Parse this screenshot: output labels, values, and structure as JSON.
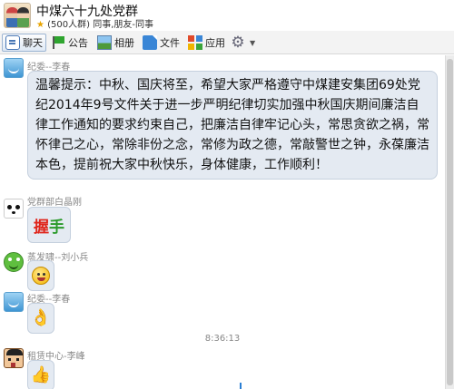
{
  "header": {
    "title": "中煤六十九处党群",
    "subtitle": "(500人群) 同事,朋友-同事"
  },
  "toolbar": {
    "items": [
      {
        "label": "聊天",
        "icon": "chat-icon",
        "active": true
      },
      {
        "label": "公告",
        "icon": "notice-flag-icon"
      },
      {
        "label": "相册",
        "icon": "album-icon"
      },
      {
        "label": "文件",
        "icon": "file-icon"
      },
      {
        "label": "应用",
        "icon": "apps-grid-icon"
      },
      {
        "label": "",
        "icon": "gear-icon"
      }
    ]
  },
  "messages": [
    {
      "sender": "纪委--李春",
      "avatar": "qq-penguin-avatar",
      "text": "温馨提示：中秋、国庆将至，希望大家严格遵守中煤建安集团69处党纪2014年9号文件关于进一步严明纪律切实加强中秋国庆期间廉洁自律工作通知的要求约束自己，把廉洁自律牢记心头，常思贪欲之祸，常怀律己之心，常除非份之念，常修为政之德，常敲警世之钟，永葆廉洁本色，提前祝大家中秋快乐，身体健康，工作顺利！"
    },
    {
      "sender": "党群部白晶刚",
      "avatar": "panda-avatar",
      "emoji": "握手",
      "emoji_icon": "handshake-sticker"
    },
    {
      "sender": "蒸发啸--刘小兵",
      "avatar": "frog-avatar",
      "emoji_icon": "grin-emoji"
    },
    {
      "sender": "纪委--李春",
      "avatar": "qq-penguin-avatar",
      "emoji_icon": "ok-hand-emoji"
    },
    {
      "sender": "租赁中心-李峰",
      "avatar": "cartoon-face-avatar",
      "emoji_icon": "thumbs-up-emoji"
    }
  ],
  "timestamp": "8:36:13"
}
